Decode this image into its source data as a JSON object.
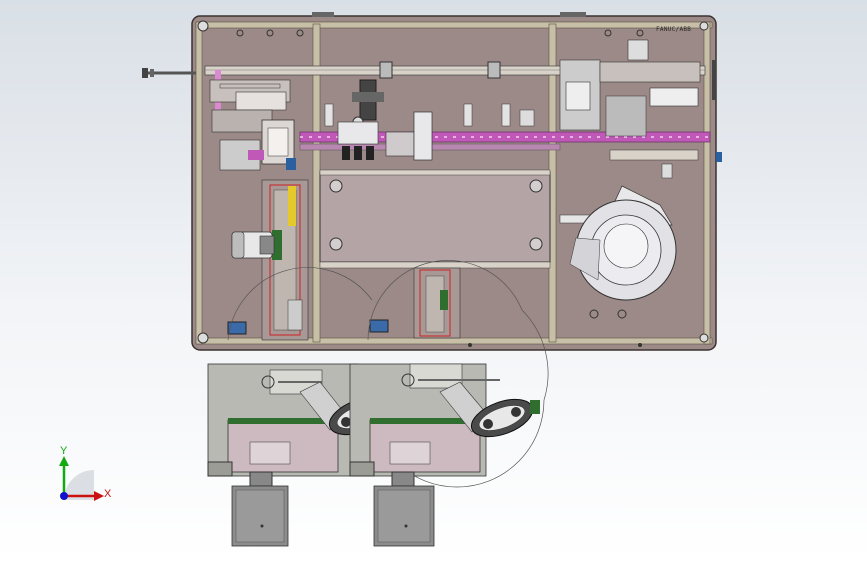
{
  "viewport": {
    "plate_badge": "FANUC/ABB",
    "triad": {
      "x_label": "X",
      "y_label": "Y"
    }
  },
  "colors": {
    "plate": "#9c8a88",
    "frame": "#c8bfa8",
    "panel": "#cdb9c0",
    "pink": "#d98ad0",
    "conveyor": "#c058b8",
    "axis_x": "#cc1111",
    "axis_y": "#11aa11",
    "axis_z": "#1111cc"
  }
}
